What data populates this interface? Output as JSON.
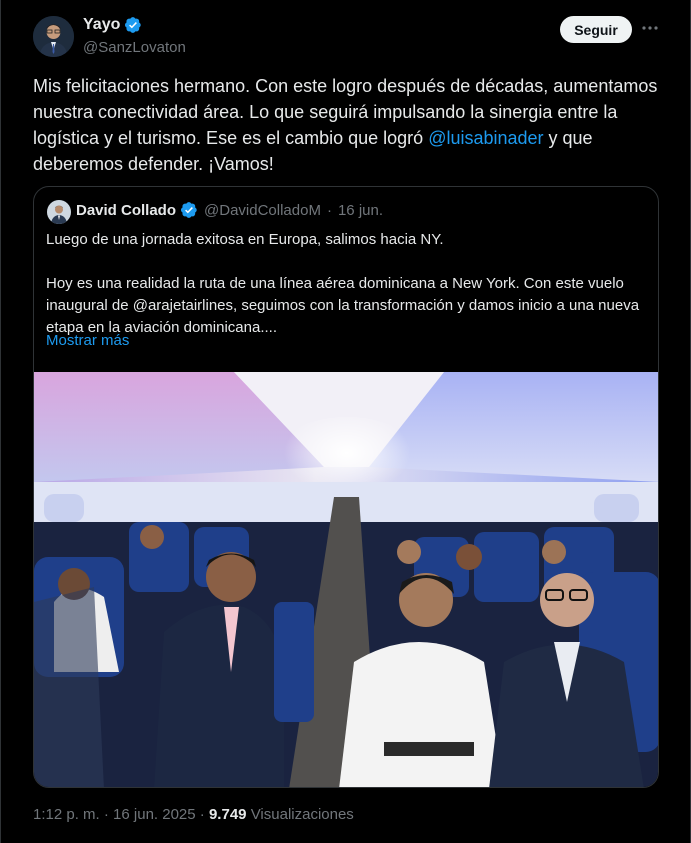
{
  "author": {
    "name": "Yayo",
    "handle": "@SanzLovaton",
    "verified": true
  },
  "follow_button": {
    "label": "Seguir"
  },
  "more_icon": "ellipsis-icon",
  "tweet": {
    "text_before": "Mis felicitaciones hermano. Con este logro después de décadas, aumentamos nuestra conectividad área. Lo que seguirá impulsando la sinergia entre la logística y el turismo. Ese es el cambio que logró ",
    "mention": "@luisabinader",
    "text_after": " y que deberemos defender. ¡Vamos!"
  },
  "quoted": {
    "name": "David Collado",
    "handle": "@DavidColladoM",
    "separator": "·",
    "date": "16 jun.",
    "paragraph1": "Luego de una jornada exitosa en Europa, salimos hacia NY.",
    "paragraph2": "Hoy es una realidad la ruta de una línea aérea dominicana a New York. Con este vuelo inaugural de @arajetairlines, seguimos con la transformación y damos inicio a una nueva etapa en la aviación dominicana....",
    "show_more": "Mostrar más"
  },
  "footer": {
    "time": "1:12 p. m.",
    "separator1": "·",
    "date": "16 jun. 2025",
    "separator2": "·",
    "views_count": "9.749",
    "views_label": "Visualizaciones"
  },
  "colors": {
    "background": "#000000",
    "text": "#e7e9ea",
    "muted": "#71767b",
    "link": "#1d9bf0",
    "border": "#2f3336"
  }
}
